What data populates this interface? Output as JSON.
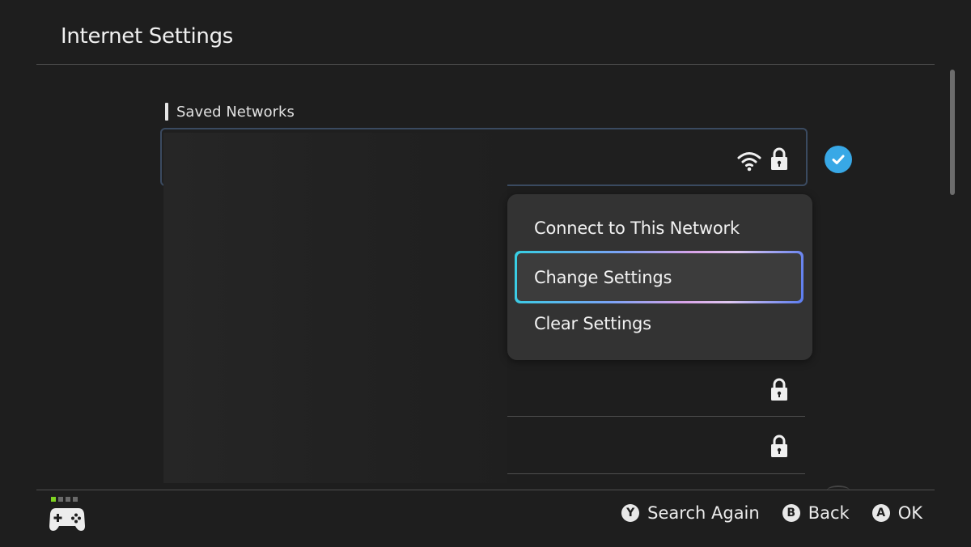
{
  "header": {
    "title": "Internet Settings"
  },
  "section": {
    "label": "Saved Networks"
  },
  "networks": [
    {
      "name": "",
      "icons": [
        "wifi-icon",
        "lock-icon"
      ],
      "connected": true
    },
    {
      "name": "",
      "icons": [
        "lock-icon"
      ],
      "connected": false
    },
    {
      "name": "",
      "icons": [
        "lock-icon"
      ],
      "connected": false
    }
  ],
  "context_menu": {
    "items": [
      {
        "label": "Connect to This Network",
        "selected": false
      },
      {
        "label": "Change Settings",
        "selected": true
      },
      {
        "label": "Clear Settings",
        "selected": false
      }
    ]
  },
  "footer": {
    "hints": [
      {
        "button": "Y",
        "label": "Search Again"
      },
      {
        "button": "B",
        "label": "Back"
      },
      {
        "button": "A",
        "label": "OK"
      }
    ]
  },
  "colors": {
    "background": "#1e1e1e",
    "accent": "#38a8e6",
    "menu_bg": "#333333",
    "indicator_active": "#7ed321"
  }
}
